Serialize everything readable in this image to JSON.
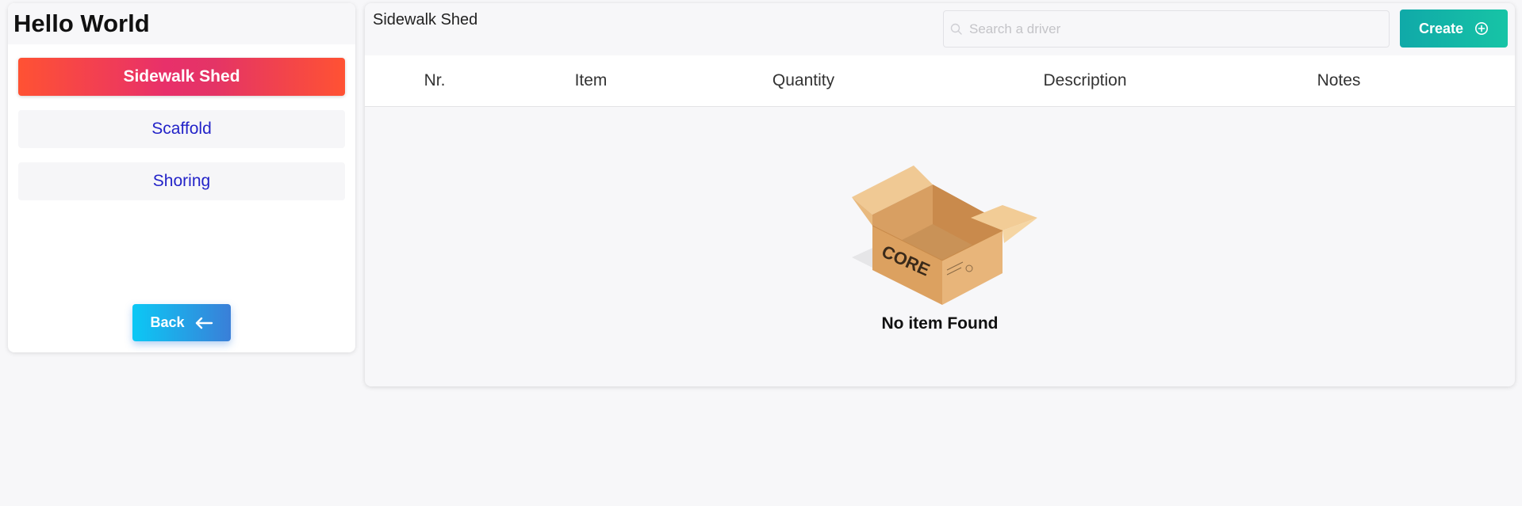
{
  "app": {
    "title": "Hello World"
  },
  "sidebar": {
    "items": [
      {
        "label": "Sidewalk Shed",
        "active": true
      },
      {
        "label": "Scaffold",
        "active": false
      },
      {
        "label": "Shoring",
        "active": false
      }
    ],
    "back_label": "Back",
    "back_icon": "arrow-left-icon"
  },
  "main": {
    "title": "Sidewalk Shed",
    "search": {
      "placeholder": "Search a driver",
      "value": "",
      "icon": "search-icon"
    },
    "create_label": "Create",
    "create_icon": "plus-circle-icon",
    "table": {
      "columns": [
        "Nr.",
        "Item",
        "Quantity",
        "Description",
        "Notes"
      ],
      "rows": []
    },
    "empty": {
      "text": "No item Found",
      "box_label": "CORE",
      "icon": "empty-box-icon"
    }
  },
  "colors": {
    "active_gradient_start": "#ff5233",
    "active_gradient_mid": "#e8306a",
    "menu_text": "#2323c8",
    "back_gradient_start": "#0bc8f5",
    "back_gradient_end": "#3a7fd8",
    "create_gradient_start": "#10a9a8",
    "create_gradient_end": "#17c4a6"
  }
}
